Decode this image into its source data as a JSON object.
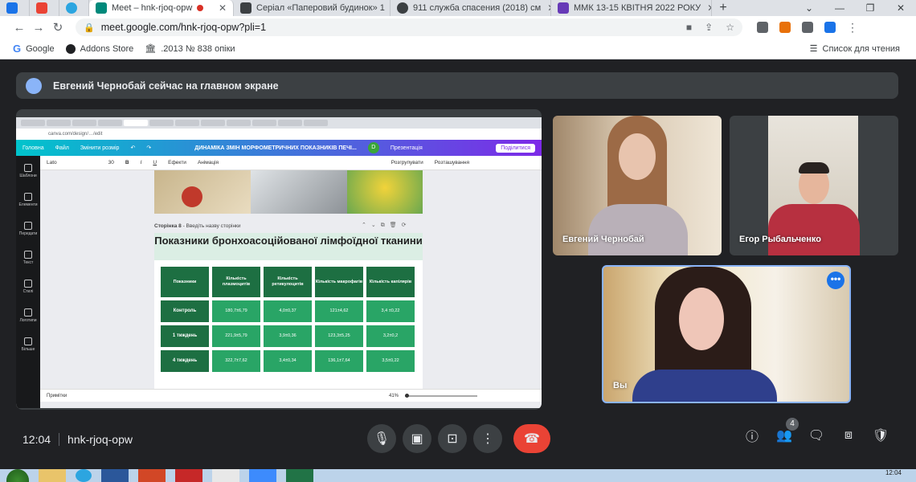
{
  "browser": {
    "tabs": [
      {
        "label": "",
        "color": "#1a73e8"
      },
      {
        "label": "",
        "color": "#ea4335"
      },
      {
        "label": "",
        "color": "#2ca5e0"
      },
      {
        "label": "Meet – hnk-rjoq-opw",
        "color": "#00897b",
        "active": true
      },
      {
        "label": "Серіал «Паперовий будинок» 1",
        "color": "#3c4043"
      },
      {
        "label": "911 служба спасения (2018) см",
        "color": "#3c4043"
      },
      {
        "label": "ММК 13-15 КВІТНЯ 2022 РОКУ",
        "color": "#673ab7"
      }
    ],
    "url": "meet.google.com/hnk-rjoq-opw?pli=1",
    "bookmarks": [
      "Google",
      "Addons Store",
      ".2013 № 838 опіки"
    ],
    "reading_list": "Список для чтения"
  },
  "meet": {
    "presenting_text": "Евгений Чернобай сейчас на главном экране",
    "time": "12:04",
    "meeting_code": "hnk-rjoq-opw",
    "participants_count": "4",
    "participants": [
      {
        "name": "Евгений Чернобай"
      },
      {
        "name": "Егор Рыбальченко"
      },
      {
        "name": "Вы"
      }
    ]
  },
  "shared_screen": {
    "canva_menu": [
      "Головна",
      "Файл",
      "Змінити розмір"
    ],
    "doc_title": "ДИНАМІКА ЗМІН МОРФОМЕТРИЧНИХ ПОКАЗНИКІВ ПЕЧІ...",
    "avatar_letter": "D",
    "present_label": "Презентація",
    "share_label": "Поділитися",
    "font_name": "Lato",
    "font_size": "30",
    "format_effects": "Ефекти",
    "format_animation": "Анімація",
    "format_group": "Розгрупувати",
    "format_arrange": "Розташування",
    "sidebar": [
      "Шаблони",
      "Елементи",
      "Передати",
      "Текст",
      "Стилі",
      "Логотипи",
      "Більше"
    ],
    "page_label": "Сторінка 8",
    "page_placeholder": "Введіть назву сторінки",
    "slide_title": "Показники бронхоасоційованої лімфоїдної тканини",
    "table_headers": [
      "Показники",
      "Кількість плазмоцитів",
      "Кількість ретикулоцитів",
      "Кількість макрофагів",
      "Кількість капілярів"
    ],
    "table_rows": [
      [
        "Контроль",
        "180,7±6,79",
        "4,0±0,37",
        "121±4,62",
        "3,4 ±0,22"
      ],
      [
        "1 тиждень",
        "221,9±5,79",
        "3,9±0,36",
        "123,3±5,25",
        "3,2±0,2"
      ],
      [
        "4 тиждень",
        "322,7±7,62",
        "3,4±0,34",
        "136,1±7,64",
        "3,5±0,22"
      ]
    ],
    "notes_label": "Примітки",
    "zoom": "41%"
  },
  "taskbar": {
    "clock": "12:04"
  }
}
